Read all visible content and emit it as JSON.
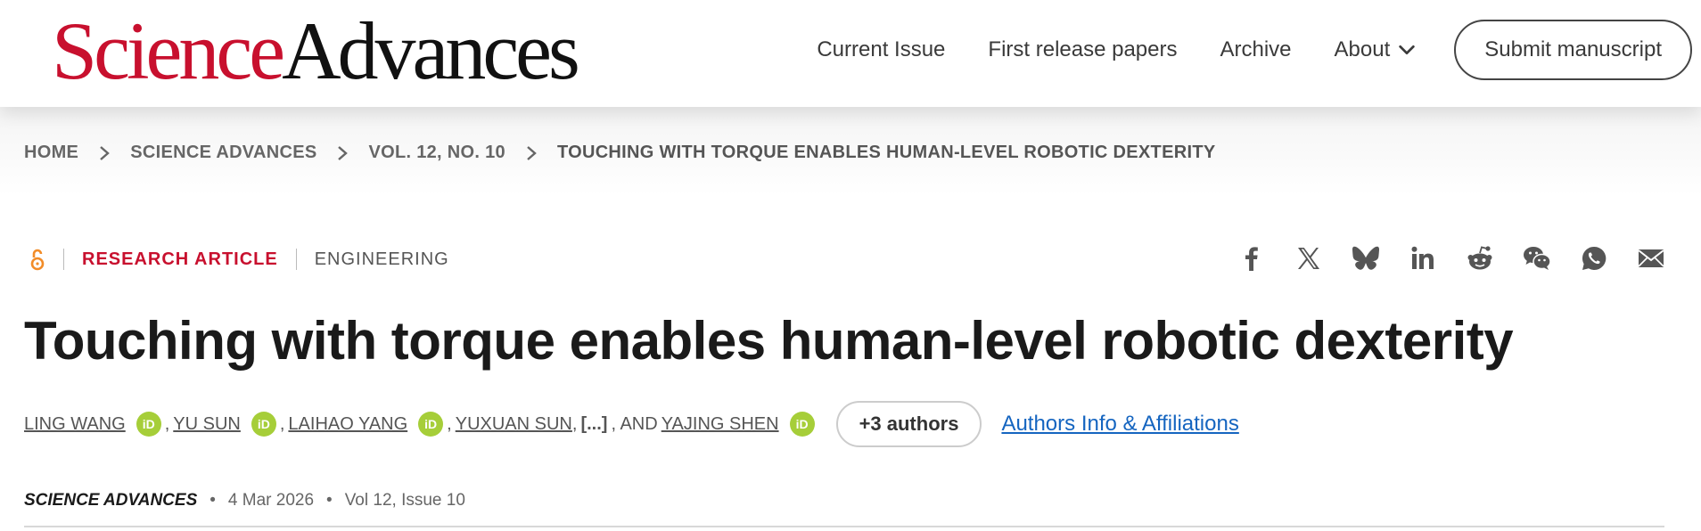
{
  "header": {
    "logo": {
      "part1": "Science",
      "part2": "Advances"
    },
    "nav": {
      "current_issue": "Current Issue",
      "first_release": "First release papers",
      "archive": "Archive",
      "about": "About",
      "submit": "Submit manuscript"
    }
  },
  "breadcrumb": [
    "HOME",
    "SCIENCE ADVANCES",
    "VOL. 12, NO. 10",
    "TOUCHING WITH TORQUE ENABLES HUMAN-LEVEL ROBOTIC DEXTERITY"
  ],
  "article": {
    "type": "RESEARCH ARTICLE",
    "subject": "ENGINEERING",
    "title": "Touching with torque enables human-level robotic dexterity",
    "authors": [
      "LING WANG",
      "YU SUN",
      "LAIHAO YANG",
      "YUXUAN SUN",
      "YAJING SHEN"
    ],
    "ellipsis": "[...]",
    "and_text": ", AND",
    "orcid_label": "iD",
    "more_authors": "+3 authors",
    "affiliations_link": "Authors Info & Affiliations",
    "journal": "SCIENCE ADVANCES",
    "date": "4 Mar 2026",
    "volume": "Vol 12, Issue 10"
  },
  "share": [
    "facebook-icon",
    "x-icon",
    "bluesky-icon",
    "linkedin-icon",
    "reddit-icon",
    "wechat-icon",
    "whatsapp-icon",
    "email-icon"
  ],
  "colors": {
    "brand_red": "#c8102e",
    "link_blue": "#1565c0",
    "orcid_green": "#a6ce39",
    "open_access_orange": "#f28c28"
  }
}
